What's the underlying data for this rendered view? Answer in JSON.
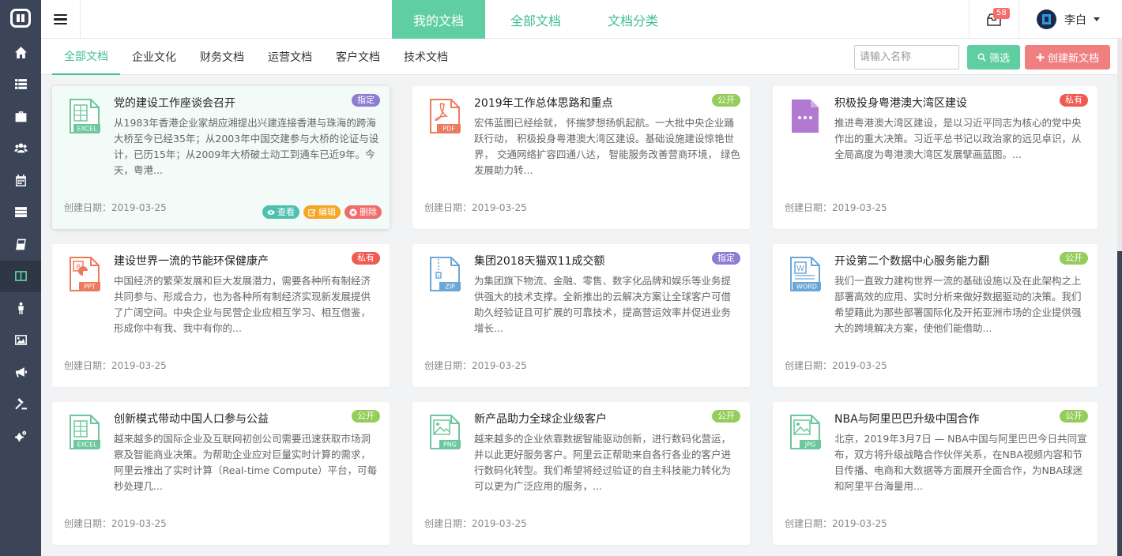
{
  "top_tabs": [
    "我的文档",
    "全部文档",
    "文档分类"
  ],
  "notifications": {
    "count": "58"
  },
  "user": {
    "name": "李白"
  },
  "categories": [
    "全部文档",
    "企业文化",
    "财务文档",
    "运营文档",
    "客户文档",
    "技术文档"
  ],
  "search": {
    "placeholder": "请输入名称"
  },
  "buttons": {
    "filter": "筛选",
    "create": "创建新文档"
  },
  "sidebar": [
    "home-icon",
    "list-icon",
    "briefcase-icon",
    "users-icon",
    "calendar-icon",
    "server-icon",
    "book-icon",
    "columns-icon",
    "person-icon",
    "image-icon",
    "megaphone-icon",
    "gavel-icon",
    "cogs-icon"
  ],
  "colors": {
    "accent": "#5fcea0",
    "sidebar": "#3c4457",
    "danger": "#f08080"
  },
  "card_actions": {
    "view": "查看",
    "edit": "编辑",
    "delete": "删除"
  },
  "docs": [
    {
      "title": "党的建设工作座谈会召开",
      "tag": "指定",
      "type": "EXCEL",
      "date": "创建日期：2019-03-25",
      "desc": "从1983年香港企业家胡应湘提出兴建连接香港与珠海的跨海大桥至今已经35年；从2003年中国交建参与大桥的论证与设计，已历15年；从2009年大桥破土动工到通车已近9年。今天，粤港..."
    },
    {
      "title": "2019年工作总体思路和重点",
      "tag": "公开",
      "type": "PDF",
      "date": "创建日期：2019-03-25",
      "desc": "宏伟蓝图已经绘就，  怀揣梦想扬帆起航。一大批中央企业踊跃行动，  积极投身粤港澳大湾区建设。基础设施建设惊艳世界，  交通网络扩容四通八达，  智能服务改善营商环境，  绿色发展助力转..."
    },
    {
      "title": "积极投身粤港澳大湾区建设",
      "tag": "私有",
      "type": "OTHER",
      "date": "创建日期：2019-03-25",
      "desc": "推进粤港澳大湾区建设，是以习近平同志为核心的党中央作出的重大决策。习近平总书记以政治家的远见卓识，从全局高度为粤港澳大湾区发展擘画蓝图。..."
    },
    {
      "title": "建设世界一流的节能环保健康产",
      "tag": "私有",
      "type": "PPT",
      "date": "创建日期：2019-03-25",
      "desc": "中国经济的繁荣发展和巨大发展潜力，需要各种所有制经济共同参与、形成合力，也为各种所有制经济实现新发展提供了广阔空间。中央企业与民营企业应相互学习、相互借鉴，形成你中有我、我中有你的..."
    },
    {
      "title": "集团2018天猫双11成交额",
      "tag": "指定",
      "type": "ZIP",
      "date": "创建日期：2019-03-25",
      "desc": "为集团旗下物流、金融、零售、数字化品牌和娱乐等业务提供强大的技术支撑。全新推出的云解决方案让全球客户可借助久经验证且可扩展的可靠技术，提高营运效率并促进业务增长..."
    },
    {
      "title": "开设第二个数据中心服务能力翻",
      "tag": "公开",
      "type": "WORD",
      "date": "创建日期：2019-03-25",
      "desc": "我们一直致力建构世界一流的基础设施以及在此架构之上部署高效的应用、实时分析来做好数据驱动的决策。我们希望藉此为那些部署国际化及开拓亚洲市场的企业提供强大的跨境解决方案，使他们能借助..."
    },
    {
      "title": "创新模式带动中国人口参与公益",
      "tag": "公开",
      "type": "EXCEL",
      "date": "创建日期：2019-03-25",
      "desc": "越来越多的国际企业及互联网初创公司需要迅速获取市场洞察及智能商业决策。为帮助企业应对巨量实时计算的需求，阿里云推出了实时计算（Real-time Compute）平台，可每秒处理几..."
    },
    {
      "title": "新产品助力全球企业级客户",
      "tag": "公开",
      "type": "PNG",
      "date": "创建日期：2019-03-25",
      "desc": "越来越多的企业依靠数据智能驱动创新，进行数码化营运，并以此更好服务客户。阿里云正帮助来自各行各业的客户进行数码化转型。我们希望将经过验证的自主科技能力转化为可以更为广泛应用的服务，..."
    },
    {
      "title": "NBA与阿里巴巴升级中国合作",
      "tag": "公开",
      "type": "JPG",
      "date": "创建日期：2019-03-25",
      "desc": "北京，2019年3月7日 — NBA中国与阿里巴巴今日共同宣布，双方将升级战略合作伙伴关系，在NBA视频内容和节目传播、电商和大数据等方面展开全面合作，为NBA球迷和阿里平台海量用..."
    }
  ]
}
